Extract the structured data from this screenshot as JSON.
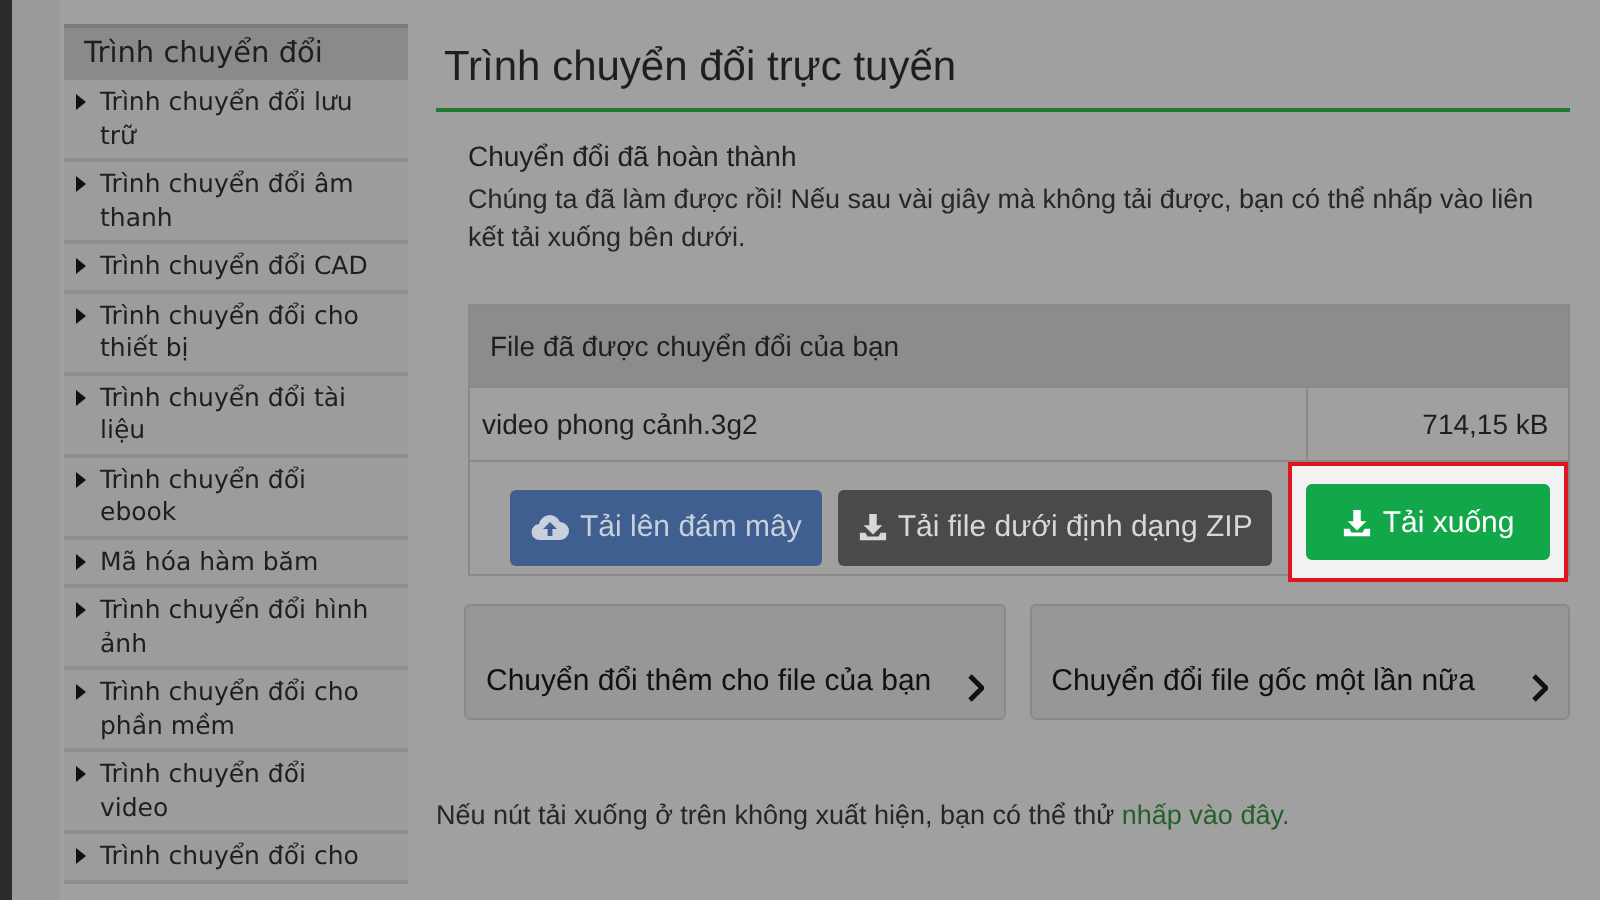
{
  "sidebar": {
    "title": "Trình chuyển đổi",
    "items": [
      {
        "label": "Trình chuyển đổi lưu trữ"
      },
      {
        "label": "Trình chuyển đổi âm thanh"
      },
      {
        "label": "Trình chuyển đổi CAD"
      },
      {
        "label": "Trình chuyển đổi cho thiết bị"
      },
      {
        "label": "Trình chuyển đổi tài liệu"
      },
      {
        "label": "Trình chuyển đổi ebook"
      },
      {
        "label": "Mã hóa hàm băm"
      },
      {
        "label": "Trình chuyển đổi hình ảnh"
      },
      {
        "label": "Trình chuyển đổi cho phần mềm"
      },
      {
        "label": "Trình chuyển đổi video"
      },
      {
        "label": "Trình chuyển đổi cho"
      }
    ]
  },
  "main": {
    "title": "Trình chuyển đổi trực tuyến",
    "status_title": "Chuyển đổi đã hoàn thành",
    "status_text": "Chúng ta đã làm được rồi! Nếu sau vài giây mà không tải được, bạn có thể nhấp vào liên kết tải xuống bên dưới.",
    "files_header": "File đã được chuyển đổi của bạn",
    "files": [
      {
        "name": "video phong cảnh.3g2",
        "size": "714,15 kB"
      }
    ],
    "buttons": [
      {
        "kind": "cloud",
        "label": "Tải lên đám mây",
        "highlighted": false
      },
      {
        "kind": "zip",
        "label": "Tải file dưới định dạng ZIP",
        "highlighted": false
      },
      {
        "kind": "download",
        "label": "Tải xuống",
        "highlighted": true
      }
    ],
    "actions": [
      {
        "label": "Chuyển đổi thêm cho file của bạn"
      },
      {
        "label": "Chuyển đổi file gốc một lần nữa"
      }
    ],
    "footer_text": "Nếu nút tải xuống ở trên không xuất hiện, bạn có thể thử",
    "footer_link": "nhấp vào đây."
  }
}
